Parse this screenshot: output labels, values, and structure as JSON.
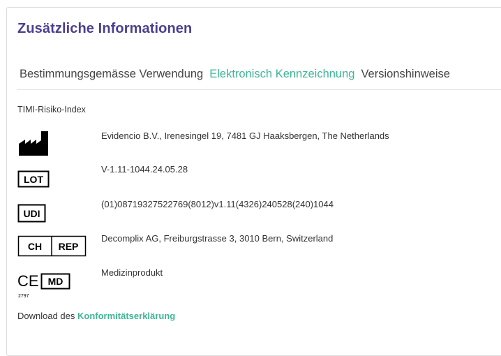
{
  "panel": {
    "title": "Zusätzliche Informationen"
  },
  "tabs": [
    {
      "label": "Bestimmungsgemässe Verwendung",
      "active": false
    },
    {
      "label": "Elektronisch Kennzeichnung",
      "active": true
    },
    {
      "label": "Versionshinweise",
      "active": false
    }
  ],
  "product_name": "TIMI-Risiko-Index",
  "labels": {
    "manufacturer": {
      "icon": "manufacturer-icon",
      "text": "Evidencio B.V., Irenesingel 19, 7481 GJ Haaksbergen, The Netherlands"
    },
    "lot": {
      "icon": "lot-icon",
      "icon_text": "LOT",
      "text": "V-1.11-1044.24.05.28"
    },
    "udi": {
      "icon": "udi-icon",
      "icon_text": "UDI",
      "text": "(01)08719327522769(8012)v1.11(4326)240528(240)1044"
    },
    "ch_rep": {
      "icon": "ch-rep-icon",
      "icon_text_left": "CH",
      "icon_text_right": "REP",
      "text": "Decomplix AG, Freiburgstrasse 3, 3010 Bern, Switzerland"
    },
    "ce_md": {
      "icon": "ce-md-icon",
      "ce_text": "CE",
      "ce_number": "2797",
      "md_text": "MD",
      "text": "Medizinprodukt"
    }
  },
  "download": {
    "prefix": "Download des",
    "link": "Konformitätserklärung"
  },
  "colors": {
    "title": "#4b3f8f",
    "accent": "#3fb597",
    "text": "#333333"
  }
}
